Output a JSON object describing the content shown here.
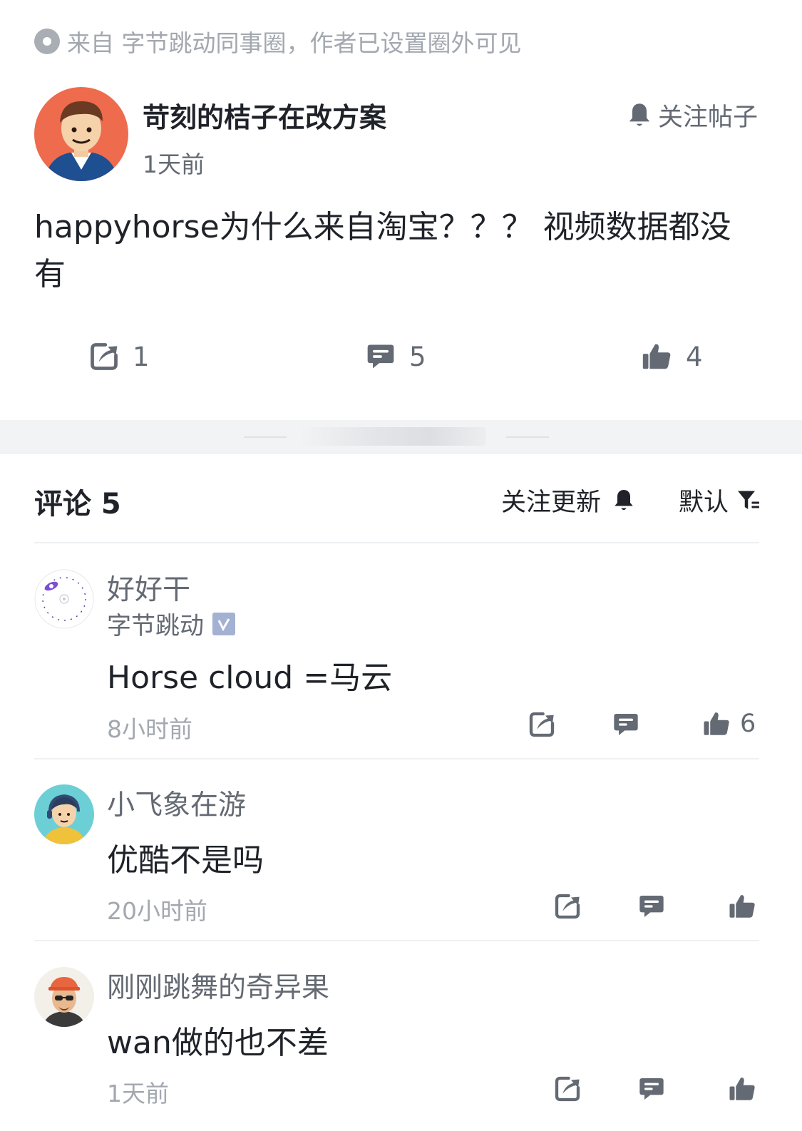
{
  "source_line": "来自 字节跳动同事圈，作者已设置圈外可见",
  "post": {
    "author": "苛刻的桔子在改方案",
    "time": "1天前",
    "follow_label": "关注帖子",
    "content": "happyhorse为什么来自淘宝？？？ 视频数据都没有",
    "share_count": "1",
    "comment_count": "5",
    "like_count": "4"
  },
  "comments_header": {
    "title": "评论 5",
    "follow_updates": "关注更新",
    "sort": "默认"
  },
  "comments": [
    {
      "name": "好好干",
      "org": "字节跳动",
      "text": "Horse cloud  =马云",
      "time": "8小时前",
      "likes": "6"
    },
    {
      "name": "小飞象在游",
      "text": "优酷不是吗",
      "time": "20小时前",
      "likes": ""
    },
    {
      "name": "刚刚跳舞的奇异果",
      "text": "wan做的也不差",
      "time": "1天前",
      "likes": ""
    }
  ],
  "icons": {
    "source": "circle-dot-icon",
    "follow": "bell-icon",
    "share": "share-arrow-icon",
    "comment": "comment-bubble-icon",
    "like": "thumbs-up-icon",
    "filter": "filter-icon",
    "verified": "verified-badge-icon"
  },
  "colors": {
    "icon_gray": "#8f959e",
    "text_gray": "#646a73",
    "light_gray": "#a3a8b0",
    "dark": "#1f2329"
  }
}
